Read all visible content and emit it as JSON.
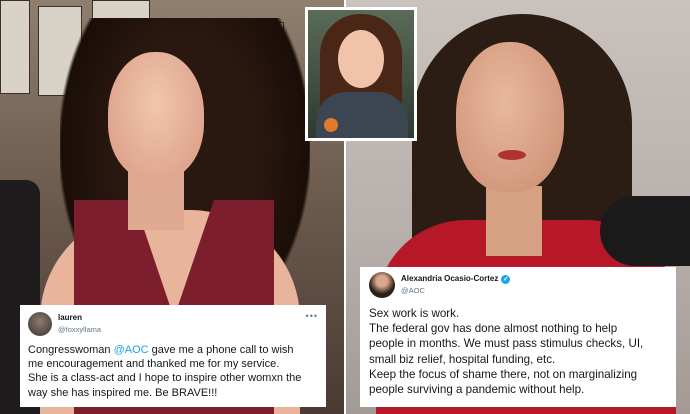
{
  "left_tweet": {
    "name": "lauren",
    "handle": "@foxxyllama",
    "more_label": "•••",
    "text_before_mention": "Congresswoman ",
    "mention": "@AOC",
    "text_after_mention": " gave me a phone call to wish",
    "line2": "me encouragement and thanked me for my service.",
    "line3": "She is a class-act and I hope to inspire other womxn the",
    "line4": "way she has inspired me. Be BRAVE!!!"
  },
  "right_tweet": {
    "name": "Alexandria Ocasio-Cortez",
    "verified_icon": "✓",
    "handle": "@AOC",
    "lines": [
      "Sex work is work.",
      "The federal gov has done almost nothing to help",
      "people in months. We must pass stimulus checks, UI,",
      "small biz relief, hospital funding, etc.",
      "Keep the focus of shame there, not on marginalizing",
      "people surviving a pandemic without help."
    ]
  },
  "colors": {
    "mention": "#1da1f2",
    "verified": "#1da1f2",
    "jacket": "#b71828",
    "top": "#7d1e2c"
  },
  "icons": {
    "verified": "verified-badge-icon",
    "more": "more-options-icon"
  }
}
